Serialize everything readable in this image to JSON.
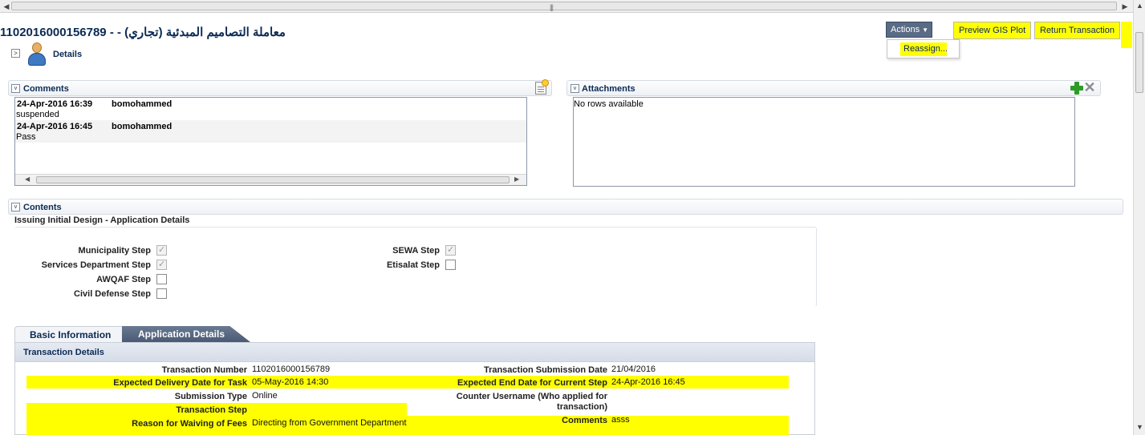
{
  "header": {
    "title": "1102016000156789 - - معاملة التصاميم المبدئية (تجاري)",
    "actions_label": "Actions",
    "preview_label": "Preview GIS Plot",
    "return_label": "Return Transaction",
    "menu_reassign": "Reassign..."
  },
  "details": {
    "label": "Details"
  },
  "comments": {
    "label": "Comments",
    "rows": [
      {
        "date": "24-Apr-2016 16:39",
        "user": "bomohammed",
        "text": "suspended"
      },
      {
        "date": "24-Apr-2016 16:45",
        "user": "bomohammed",
        "text": "Pass"
      }
    ]
  },
  "attachments": {
    "label": "Attachments",
    "empty": "No rows available"
  },
  "contents": {
    "label": "Contents",
    "subheading": "Issuing Initial Design - Application Details",
    "steps_left": [
      {
        "label": "Municipality Step",
        "checked": true
      },
      {
        "label": "Services Department Step",
        "checked": true
      },
      {
        "label": "AWQAF Step",
        "checked": false
      },
      {
        "label": "Civil Defense Step",
        "checked": false
      }
    ],
    "steps_right": [
      {
        "label": "SEWA Step",
        "checked": true
      },
      {
        "label": "Etisalat Step",
        "checked": false
      }
    ]
  },
  "tabs": {
    "basic": "Basic Information",
    "app": "Application Details"
  },
  "transaction": {
    "heading": "Transaction Details",
    "number_label": "Transaction Number",
    "number_value": "1102016000156789",
    "submission_date_label": "Transaction Submission Date",
    "submission_date_value": "21/04/2016",
    "expected_delivery_label": "Expected Delivery Date for Task",
    "expected_delivery_value": "05-May-2016 14:30",
    "expected_end_label": "Expected End Date for Current Step",
    "expected_end_value": "24-Apr-2016 16:45",
    "submission_type_label": "Submission Type",
    "submission_type_value": "Online",
    "counter_label_1": "Counter Username (Who applied for",
    "counter_label_2": "transaction)",
    "step_label": "Transaction Step",
    "waiving_label": "Reason for Waiving of Fees",
    "waiving_value": "Directing from Government Department",
    "comments_label": "Comments",
    "comments_value": "asss"
  },
  "colors": {
    "highlight": "#ffff00",
    "navy": "#0a2a55",
    "actions_bg": "#5a6b86"
  }
}
